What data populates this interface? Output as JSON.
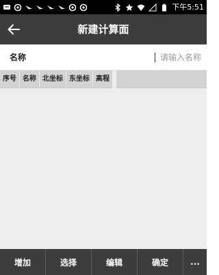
{
  "status_bar": {
    "left_icons": [
      "message-icon",
      "sync-icon",
      "signal-arrow-icon",
      "signal-arrow-icon",
      "signal-arrow-icon",
      "signal-arrow-icon",
      "sync-icon",
      "sync-icon"
    ],
    "right_icons": [
      "bluetooth-icon",
      "star-icon",
      "wifi-icon",
      "cellular-icon",
      "battery-icon"
    ],
    "time": "下午5:51"
  },
  "header": {
    "title": "新建计算面",
    "back_icon": "arrow-left-icon"
  },
  "form": {
    "name_label": "名称",
    "name_placeholder": "请输入名称",
    "name_value": ""
  },
  "table": {
    "columns": [
      "序号",
      "名称",
      "北坐标",
      "东坐标",
      "高程"
    ],
    "rows": []
  },
  "toolbar": {
    "add_label": "增加",
    "select_label": "选择",
    "edit_label": "编辑",
    "confirm_label": "确定",
    "more_label": "..."
  },
  "colors": {
    "header_bg": "#3d3d3d",
    "toolbar_bg": "#3d3d3d",
    "table_header_bg": "#d3d3d3",
    "table_body_bg": "#eeeeee",
    "status_bar_bg": "#000000"
  }
}
